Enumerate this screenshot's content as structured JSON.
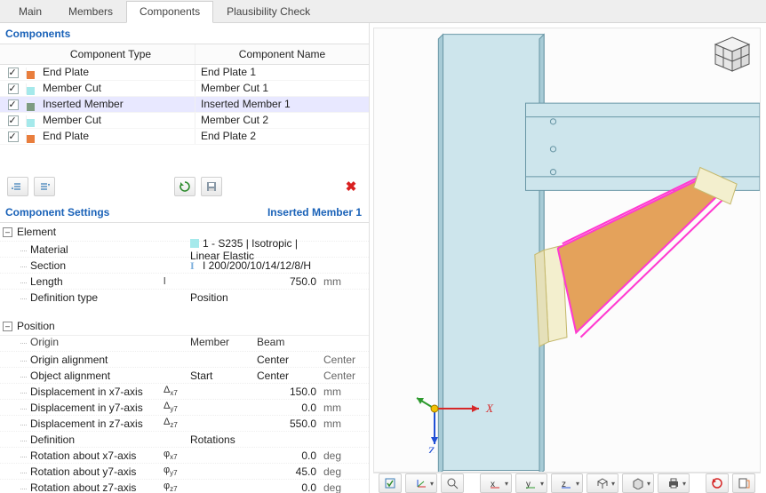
{
  "tabs": {
    "main": "Main",
    "members": "Members",
    "components": "Components",
    "plaus": "Plausibility Check"
  },
  "components": {
    "title": "Components",
    "headers": {
      "type": "Component Type",
      "name": "Component Name"
    },
    "rows": [
      {
        "type": "End Plate",
        "name": "End Plate 1",
        "color": "#e97e3d"
      },
      {
        "type": "Member Cut",
        "name": "Member Cut 1",
        "color": "#a5e9eb"
      },
      {
        "type": "Inserted Member",
        "name": "Inserted Member 1",
        "color": "#7e9c82"
      },
      {
        "type": "Member Cut",
        "name": "Member Cut 2",
        "color": "#a5e9eb"
      },
      {
        "type": "End Plate",
        "name": "End Plate 2",
        "color": "#e97e3d"
      }
    ]
  },
  "settings": {
    "title": "Component Settings",
    "subject": "Inserted Member 1",
    "element": {
      "label": "Element",
      "material_lbl": "Material",
      "material_val": "1 - S235 | Isotropic | Linear Elastic",
      "section_lbl": "Section",
      "section_val": "I 200/200/10/14/12/8/H",
      "length_lbl": "Length",
      "length_sym": "l",
      "length_val": "750.0",
      "length_unit": "mm",
      "deftype_lbl": "Definition type",
      "deftype_val": "Position"
    },
    "position": {
      "label": "Position",
      "col_member": "Member",
      "col_beam": "Beam",
      "origin_lbl": "Origin",
      "oalign_lbl": "Origin alignment",
      "oalign_a": "Center",
      "oalign_b": "Center",
      "objal_lbl": "Object alignment",
      "objal_a": "Start",
      "objal_b1": "Center",
      "objal_b2": "Center",
      "dx_lbl": "Displacement in x7-axis",
      "dx_sym": "Δx7",
      "dx_val": "150.0",
      "dx_u": "mm",
      "dy_lbl": "Displacement in y7-axis",
      "dy_sym": "Δy7",
      "dy_val": "0.0",
      "dy_u": "mm",
      "dz_lbl": "Displacement in z7-axis",
      "dz_sym": "Δz7",
      "dz_val": "550.0",
      "dz_u": "mm",
      "def_lbl": "Definition",
      "def_val": "Rotations",
      "rx_lbl": "Rotation about x7-axis",
      "rx_sym": "φx7",
      "rx_val": "0.0",
      "rx_u": "deg",
      "ry_lbl": "Rotation about y7-axis",
      "ry_sym": "φy7",
      "ry_val": "45.0",
      "ry_u": "deg",
      "rz_lbl": "Rotation about z7-axis",
      "rz_sym": "φz7",
      "rz_val": "0.0",
      "rz_u": "deg"
    }
  },
  "viewport": {
    "axis_x": "X",
    "axis_z": "Z"
  }
}
